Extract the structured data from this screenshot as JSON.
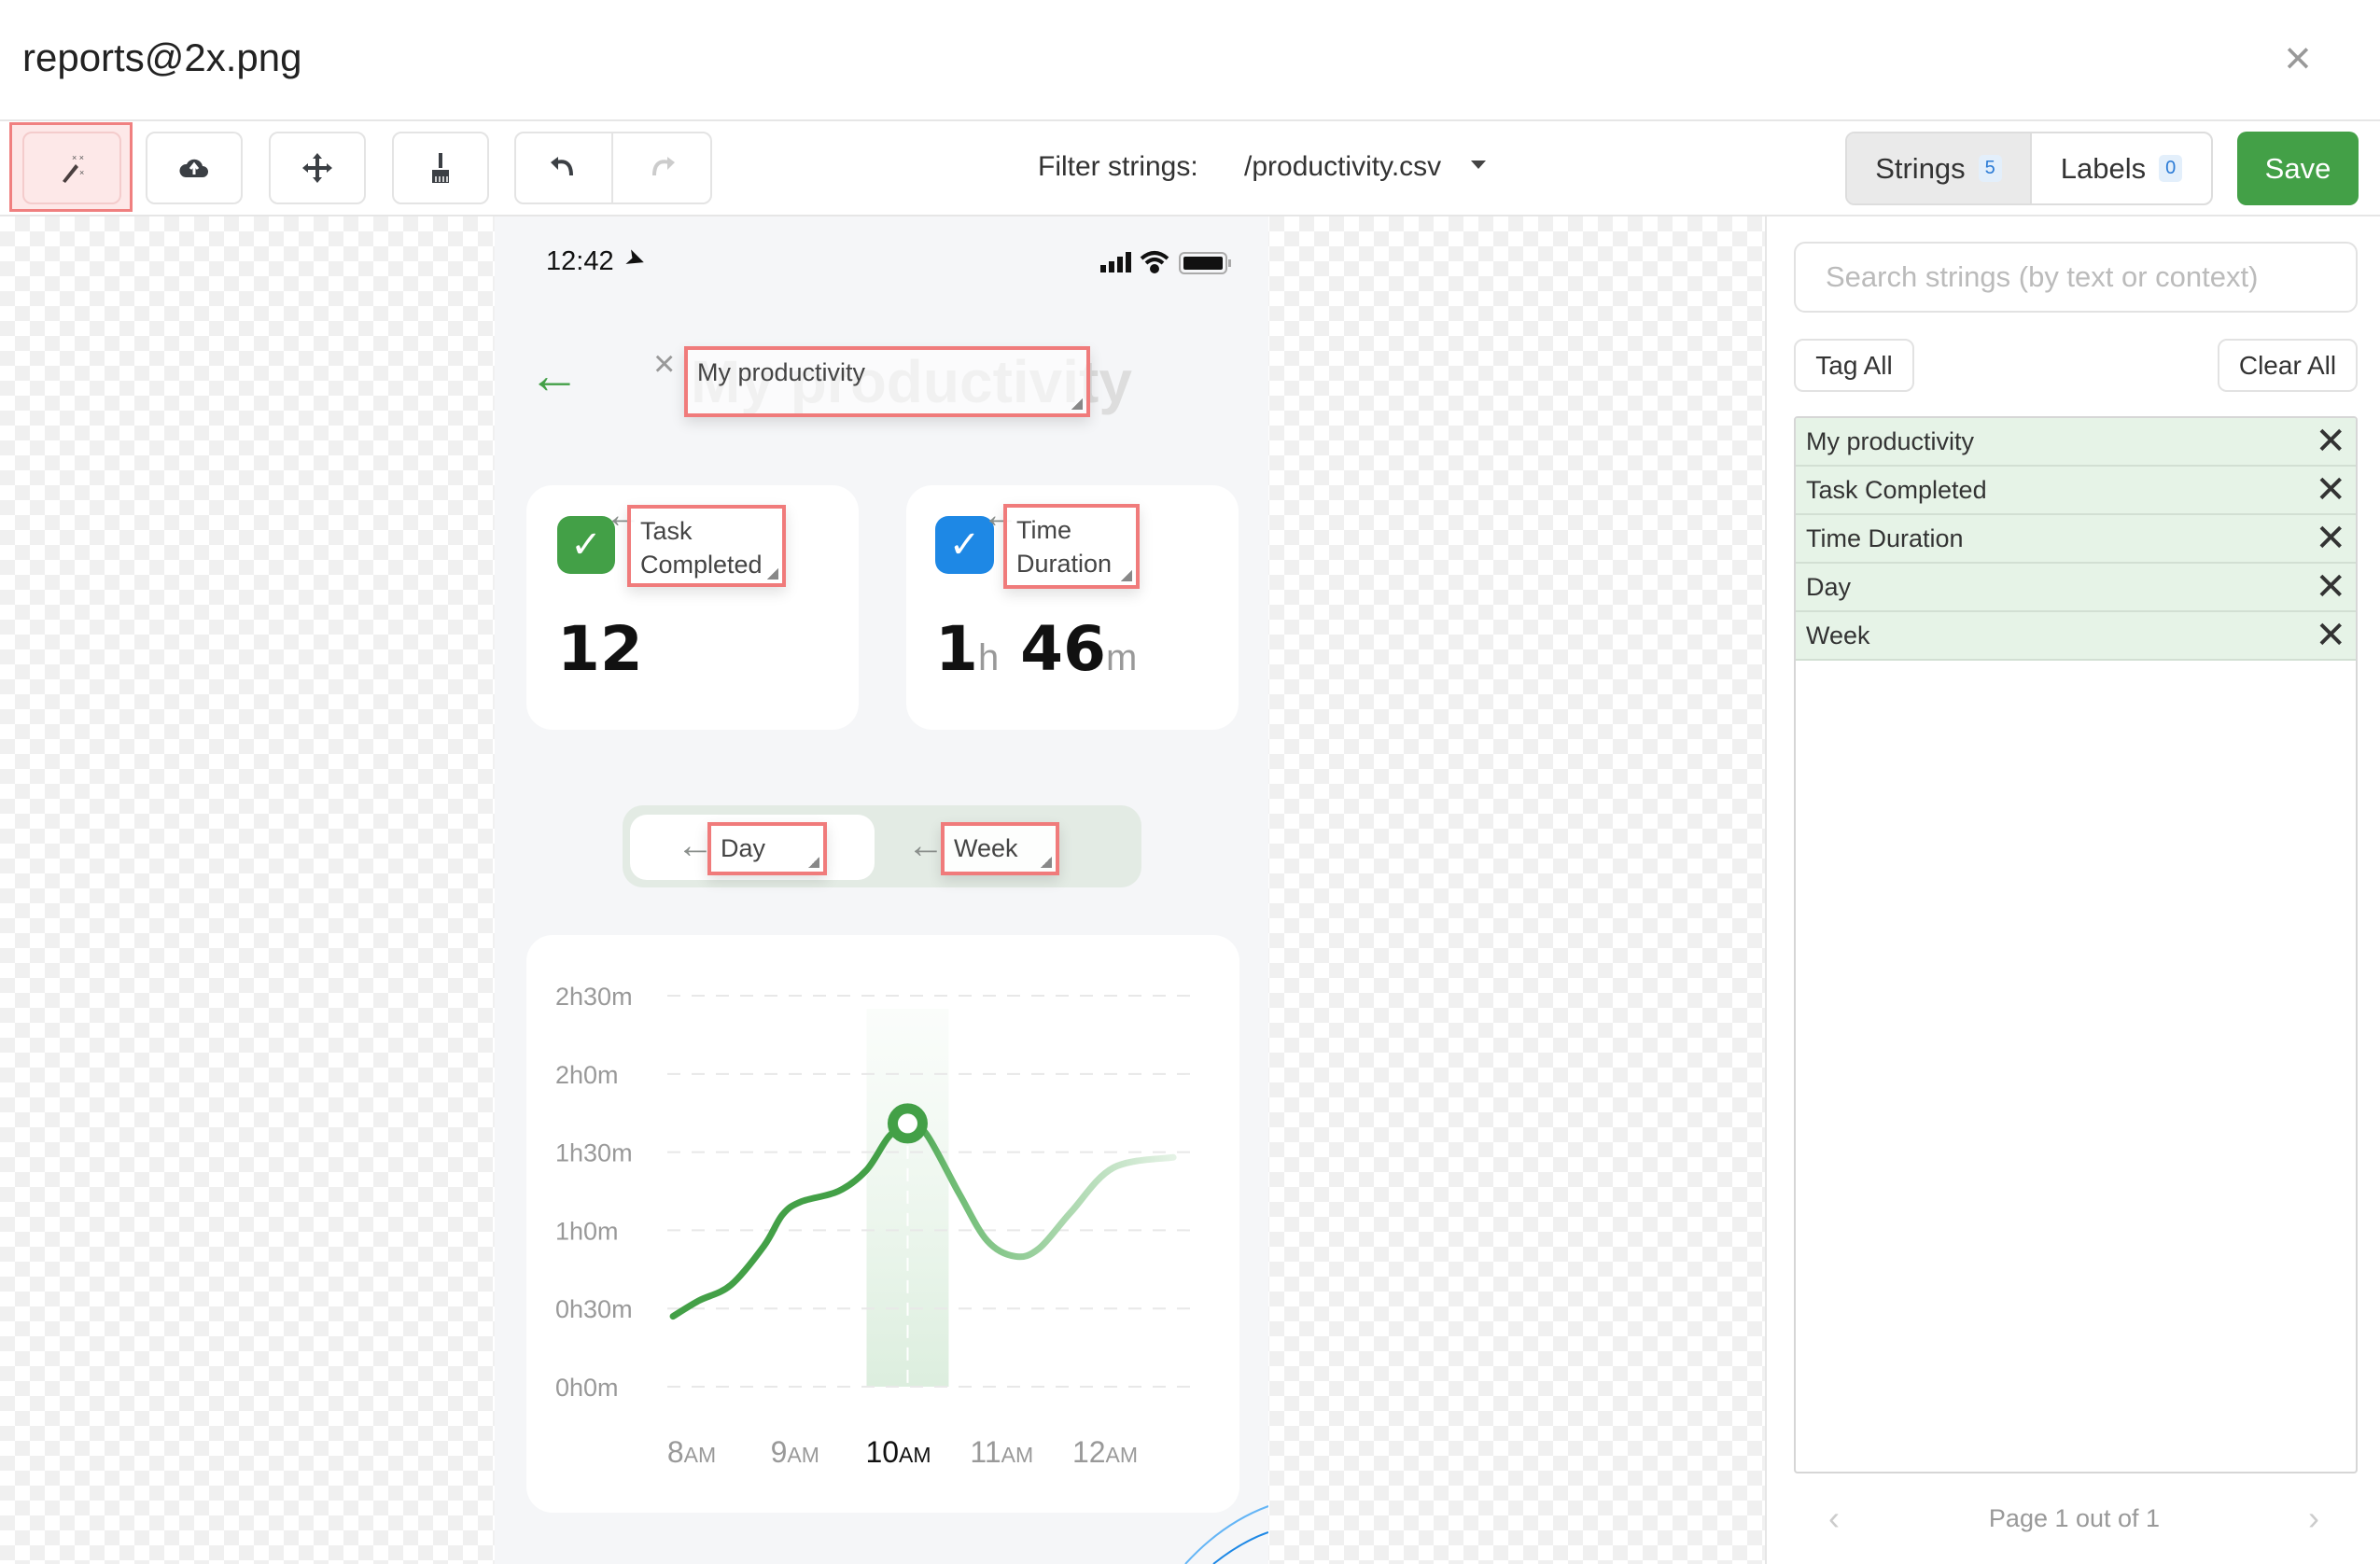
{
  "window": {
    "title": "reports@2x.png",
    "close_icon": "close-icon"
  },
  "toolbar": {
    "tools": [
      {
        "icon": "magic-wand-icon",
        "active": true
      },
      {
        "icon": "cloud-upload-icon"
      },
      {
        "icon": "move-arrows-icon"
      },
      {
        "icon": "broom-icon"
      },
      {
        "icon": "undo-icon"
      },
      {
        "icon": "redo-icon",
        "disabled": true
      }
    ],
    "filter_label": "Filter strings:",
    "filter_value": "/productivity.csv",
    "tabs": [
      {
        "label": "Strings",
        "count": "5",
        "active": true
      },
      {
        "label": "Labels",
        "count": "0"
      }
    ],
    "save_label": "Save",
    "accent": "#43a047",
    "highlight": "#f07b7b"
  },
  "phone": {
    "time": "12:42",
    "title": "My productivity",
    "cards": [
      {
        "label_line1": "Task",
        "label_line2": "Completed",
        "label": "Task Completed",
        "value": "12",
        "color": "#43a047"
      },
      {
        "label_line1": "Time",
        "label_line2": "Duration",
        "label": "Time Duration",
        "hours": "1",
        "h": "h",
        "minutes": "46",
        "m": "m",
        "color": "#1e88e5"
      }
    ],
    "toggle": {
      "day": "Day",
      "week": "Week",
      "selected": "Day"
    }
  },
  "chart_data": {
    "type": "line",
    "y_tick_labels": [
      "0h0m",
      "0h30m",
      "1h0m",
      "1h30m",
      "2h0m",
      "2h30m"
    ],
    "y_ticks_minutes": [
      0,
      30,
      60,
      90,
      120,
      150
    ],
    "ylim": [
      0,
      150
    ],
    "x_tick_labels": [
      {
        "num": "8",
        "suffix": "AM",
        "hour": 8
      },
      {
        "num": "9",
        "suffix": "AM",
        "hour": 9
      },
      {
        "num": "10",
        "suffix": "AM",
        "hour": 10,
        "selected": true
      },
      {
        "num": "11",
        "suffix": "AM",
        "hour": 11
      },
      {
        "num": "12",
        "suffix": "AM",
        "hour": 12
      }
    ],
    "grid": true,
    "selected_point": {
      "hour": 10.09,
      "minutes": 101
    },
    "series": [
      {
        "x": [
          7.82,
          8.07,
          8.38,
          8.7,
          8.88,
          9.06,
          9.42,
          9.69,
          9.91,
          10.09,
          10.27,
          10.59,
          10.86,
          11.13,
          11.36,
          11.67,
          12.08,
          12.66
        ],
        "y": [
          27,
          33,
          39,
          54,
          66,
          71,
          75,
          83,
          96,
          101,
          97,
          74,
          56,
          50,
          53,
          67,
          84,
          88
        ],
        "color": "#43a047"
      }
    ]
  },
  "panel": {
    "search_placeholder": "Search strings (by text or context)",
    "tag_all": "Tag All",
    "clear_all": "Clear All",
    "strings": [
      "My productivity",
      "Task Completed",
      "Time Duration",
      "Day",
      "Week"
    ],
    "pager": "Page 1 out of 1"
  }
}
